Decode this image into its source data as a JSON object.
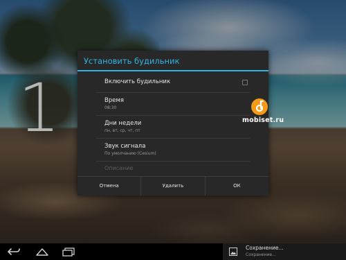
{
  "dialog": {
    "title": "Установить будильник",
    "enable": {
      "label": "Включить будильник",
      "checked": false
    },
    "time": {
      "label": "Время",
      "value": "08:30"
    },
    "days": {
      "label": "Дни недели",
      "value": "пн, вт, ср, чт, пт"
    },
    "sound": {
      "label": "Звук сигнала",
      "value": "По умолчанию (Cesium)"
    },
    "description": {
      "placeholder": "Описание"
    },
    "buttons": {
      "cancel": "Отмена",
      "delete": "Удалить",
      "ok": "ОК"
    }
  },
  "clock": {
    "digit": "1"
  },
  "watermark": {
    "text": "mobiset.ru",
    "icon": "mobiset-logo-icon"
  },
  "notification": {
    "title": "Сохранение...",
    "subtitle": "Сохранение...",
    "icon": "image-icon"
  },
  "nav": {
    "icons": [
      "back-icon",
      "home-icon",
      "recent-apps-icon"
    ]
  },
  "colors": {
    "accent": "#33b5e5",
    "dialog_bg": "#282828",
    "watermark_orange": "#f39a16"
  }
}
